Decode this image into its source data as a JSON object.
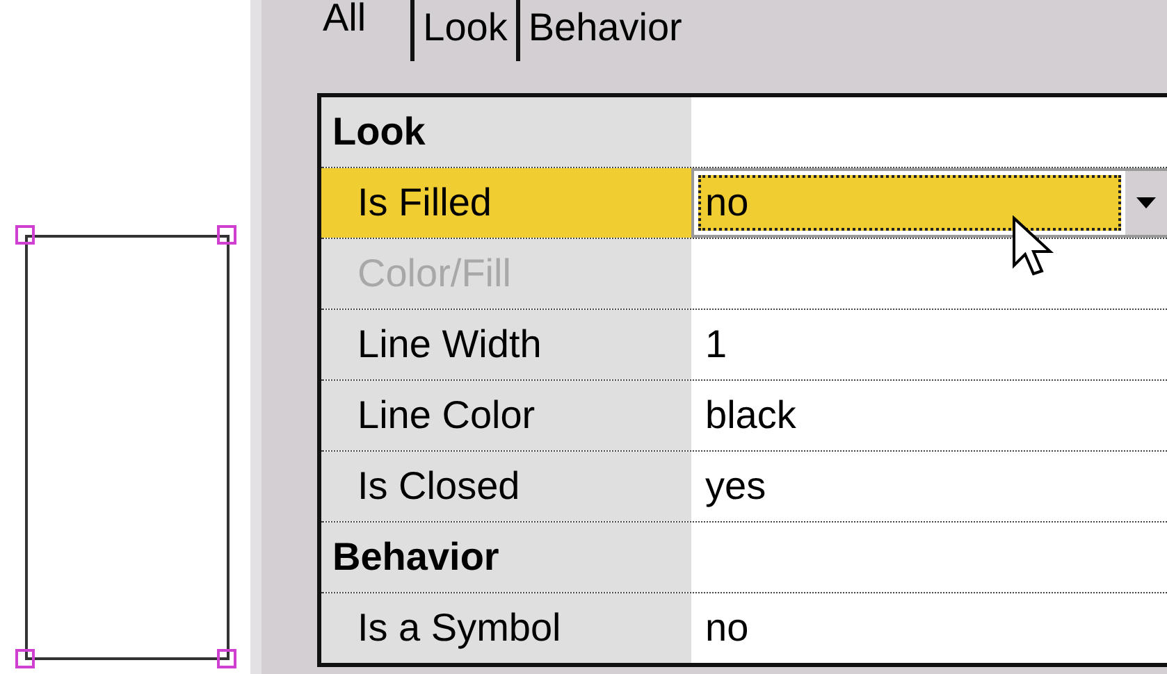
{
  "canvas": {
    "shapes": [
      {
        "kind": "rectangle",
        "selected": true
      }
    ]
  },
  "tabs": [
    {
      "label": "All",
      "selected": true
    },
    {
      "label": "Look",
      "selected": false
    },
    {
      "label": "Behavior",
      "selected": false
    }
  ],
  "property_grid": {
    "sections": [
      {
        "title": "Look",
        "rows": [
          {
            "name": "Is Filled",
            "value": "no",
            "kind": "dropdown",
            "selected": true,
            "disabled": false
          },
          {
            "name": "Color/Fill",
            "kind": "text",
            "selected": false,
            "disabled": true
          },
          {
            "name": "Line Width",
            "value": "1",
            "kind": "text",
            "selected": false,
            "disabled": false
          },
          {
            "name": "Line Color",
            "value": "black",
            "kind": "text",
            "selected": false,
            "disabled": false
          },
          {
            "name": "Is Closed",
            "value": "yes",
            "kind": "text",
            "selected": false,
            "disabled": false
          }
        ]
      },
      {
        "title": "Behavior",
        "rows": [
          {
            "name": "Is a Symbol",
            "value": "no",
            "kind": "text",
            "selected": false,
            "disabled": false
          }
        ]
      }
    ]
  }
}
